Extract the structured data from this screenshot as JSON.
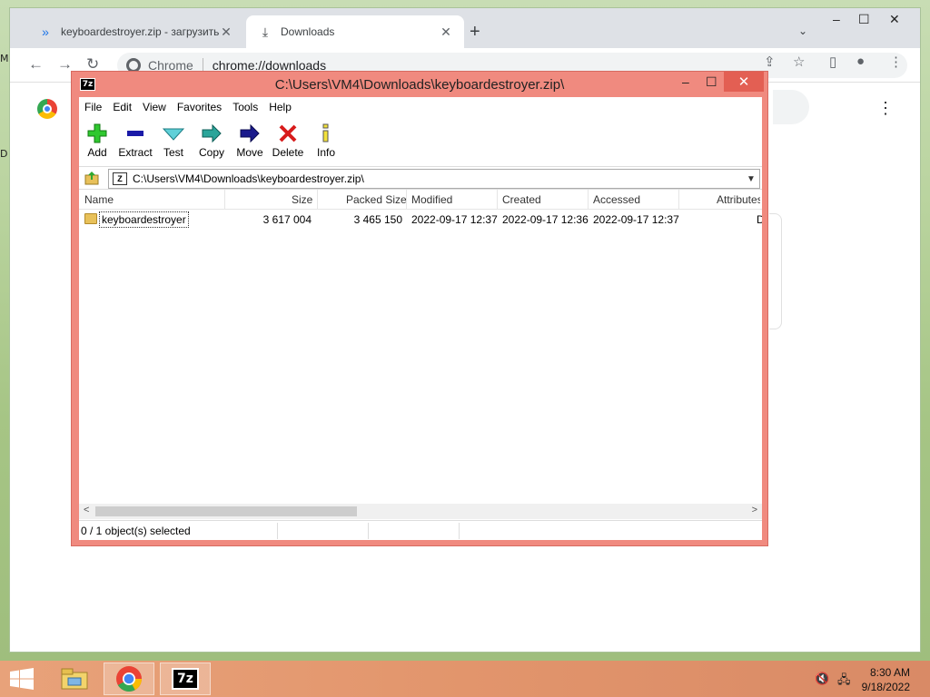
{
  "desktop": {
    "frag_top": "M",
    "frag_mid": "D"
  },
  "browser": {
    "tabs": [
      {
        "label": "keyboardestroyer.zip - загрузить",
        "icon": "chevrons-icon"
      },
      {
        "label": "Downloads",
        "icon": "download-icon"
      }
    ],
    "omnibox": {
      "chip": "Chrome",
      "url": "chrome://downloads"
    }
  },
  "zip": {
    "title": "C:\\Users\\VM4\\Downloads\\keyboardestroyer.zip\\",
    "logo": "7z",
    "menu": [
      "File",
      "Edit",
      "View",
      "Favorites",
      "Tools",
      "Help"
    ],
    "toolbar": [
      "Add",
      "Extract",
      "Test",
      "Copy",
      "Move",
      "Delete",
      "Info"
    ],
    "path": "C:\\Users\\VM4\\Downloads\\keyboardestroyer.zip\\",
    "columns": [
      "Name",
      "Size",
      "Packed Size",
      "Modified",
      "Created",
      "Accessed",
      "Attributes"
    ],
    "rows": [
      {
        "name": "keyboardestroyer",
        "size": "3 617 004",
        "packed": "3 465 150",
        "modified": "2022-09-17 12:37",
        "created": "2022-09-17 12:36",
        "accessed": "2022-09-17 12:37",
        "attributes": "D"
      }
    ],
    "status": "0 / 1 object(s) selected"
  },
  "taskbar": {
    "time": "8:30 AM",
    "date": "9/18/2022",
    "app_7z": "7z"
  },
  "colors": {
    "zip_frame": "#f08a7f",
    "taskbar": "#e2956c",
    "desktop": "#b9d39e"
  }
}
